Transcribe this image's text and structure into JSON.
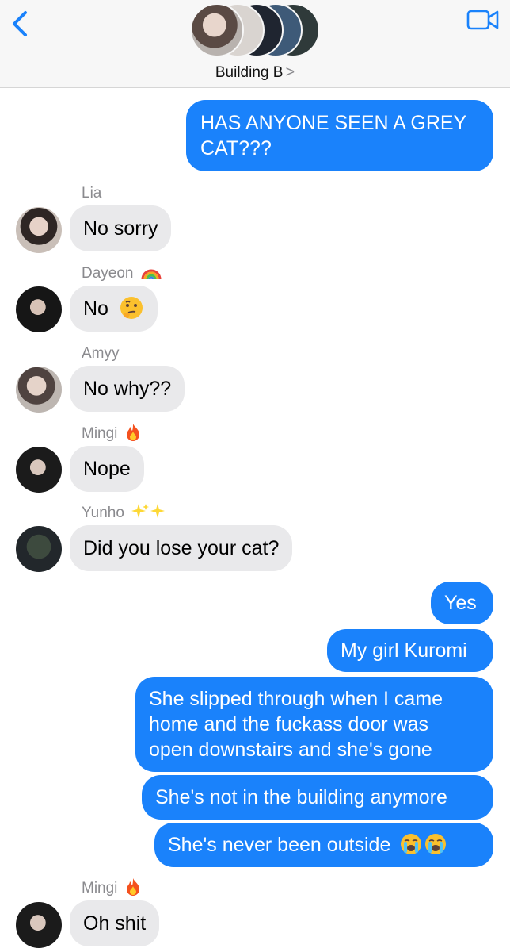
{
  "header": {
    "group_name": "Building B",
    "chevron": ">",
    "back_icon": "chevron-left-icon",
    "video_icon": "video-camera-icon",
    "accent_color": "#1a82fb"
  },
  "messages": [
    {
      "direction": "outgoing",
      "text_lines": [
        "HAS ANYONE SEEN A GREY",
        "CAT???"
      ]
    },
    {
      "direction": "incoming",
      "sender": "Lia",
      "text": "No sorry"
    },
    {
      "direction": "incoming",
      "sender": "Dayeon",
      "sender_emoji": "rainbow",
      "text": "No",
      "emoji": "thinking-face"
    },
    {
      "direction": "incoming",
      "sender": "Amyy",
      "text": "No why??"
    },
    {
      "direction": "incoming",
      "sender": "Mingi",
      "sender_emoji": "fire",
      "text": "Nope"
    },
    {
      "direction": "incoming",
      "sender": "Yunho",
      "sender_emoji": "sparkles",
      "text": "Did you lose your cat?"
    },
    {
      "direction": "outgoing",
      "text": "Yes"
    },
    {
      "direction": "outgoing",
      "text": "My girl Kuromi"
    },
    {
      "direction": "outgoing",
      "text_lines": [
        "She slipped through when I came",
        "home and the fuckass door was",
        "open downstairs and she's gone"
      ]
    },
    {
      "direction": "outgoing",
      "text": "She's not in the building anymore"
    },
    {
      "direction": "outgoing",
      "text": "She's never been outside",
      "emoji": "loudly-crying-face x2"
    },
    {
      "direction": "incoming",
      "sender": "Mingi",
      "sender_emoji": "fire",
      "text": "Oh shit"
    }
  ],
  "colors": {
    "outgoing_bubble": "#1a82fb",
    "incoming_bubble": "#e9e9eb",
    "sender_label": "#8a8a8e"
  }
}
